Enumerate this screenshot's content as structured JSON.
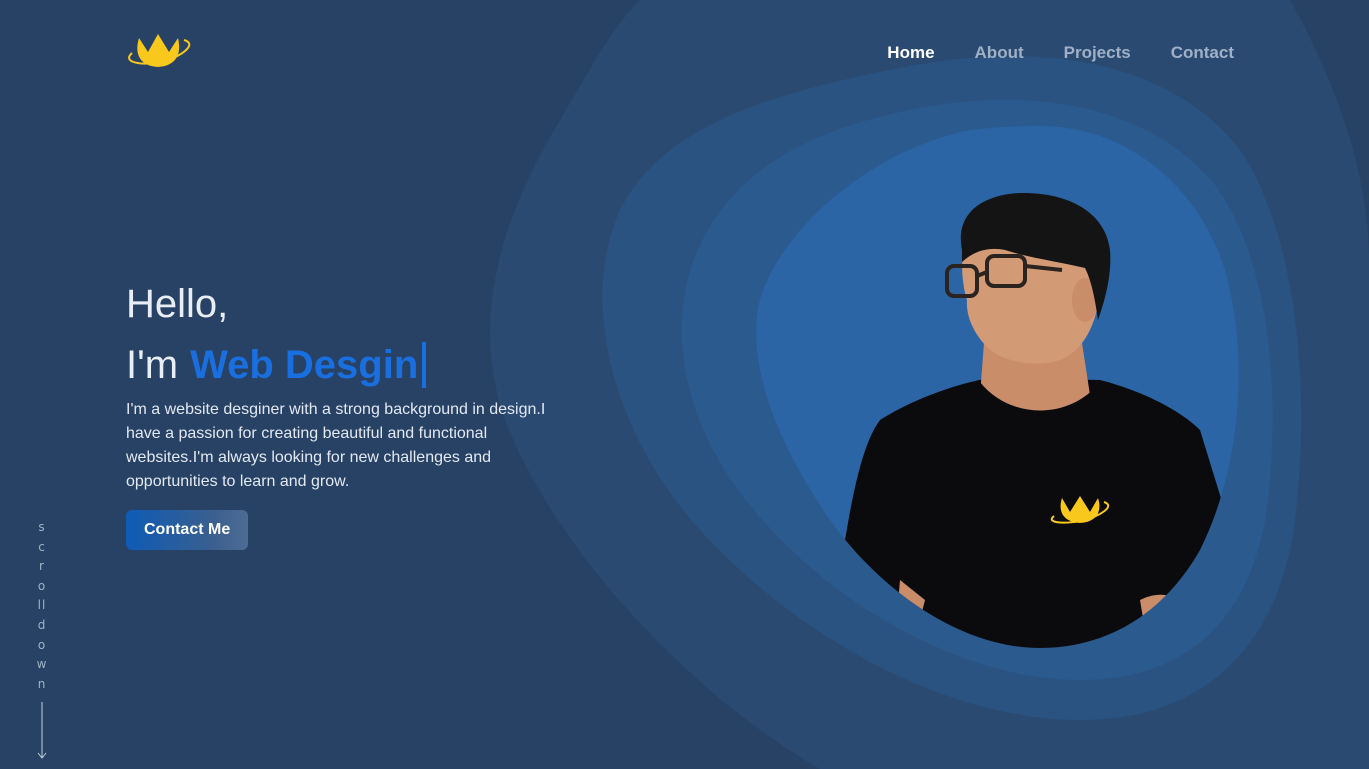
{
  "nav": {
    "items": [
      {
        "label": "Home",
        "active": true
      },
      {
        "label": "About",
        "active": false
      },
      {
        "label": "Projects",
        "active": false
      },
      {
        "label": "Contact",
        "active": false
      }
    ]
  },
  "hero": {
    "greeting": "Hello,",
    "prefix": "I'm",
    "role": "Web Desgin",
    "intro": "I'm a website desginer with a strong background in design.I have a passion for creating beautiful and functional websites.I'm always looking for new challenges and opportunities to learn and grow.",
    "cta_label": "Contact Me"
  },
  "scroll": {
    "text": "scroll down"
  },
  "colors": {
    "background": "#274264",
    "accent": "#1a6fe0",
    "logo": "#f8c81c",
    "portrait_bg": "#2b65a6"
  },
  "icons": {
    "logo": "crown-planet-logo",
    "scroll": "arrow-down-icon"
  }
}
